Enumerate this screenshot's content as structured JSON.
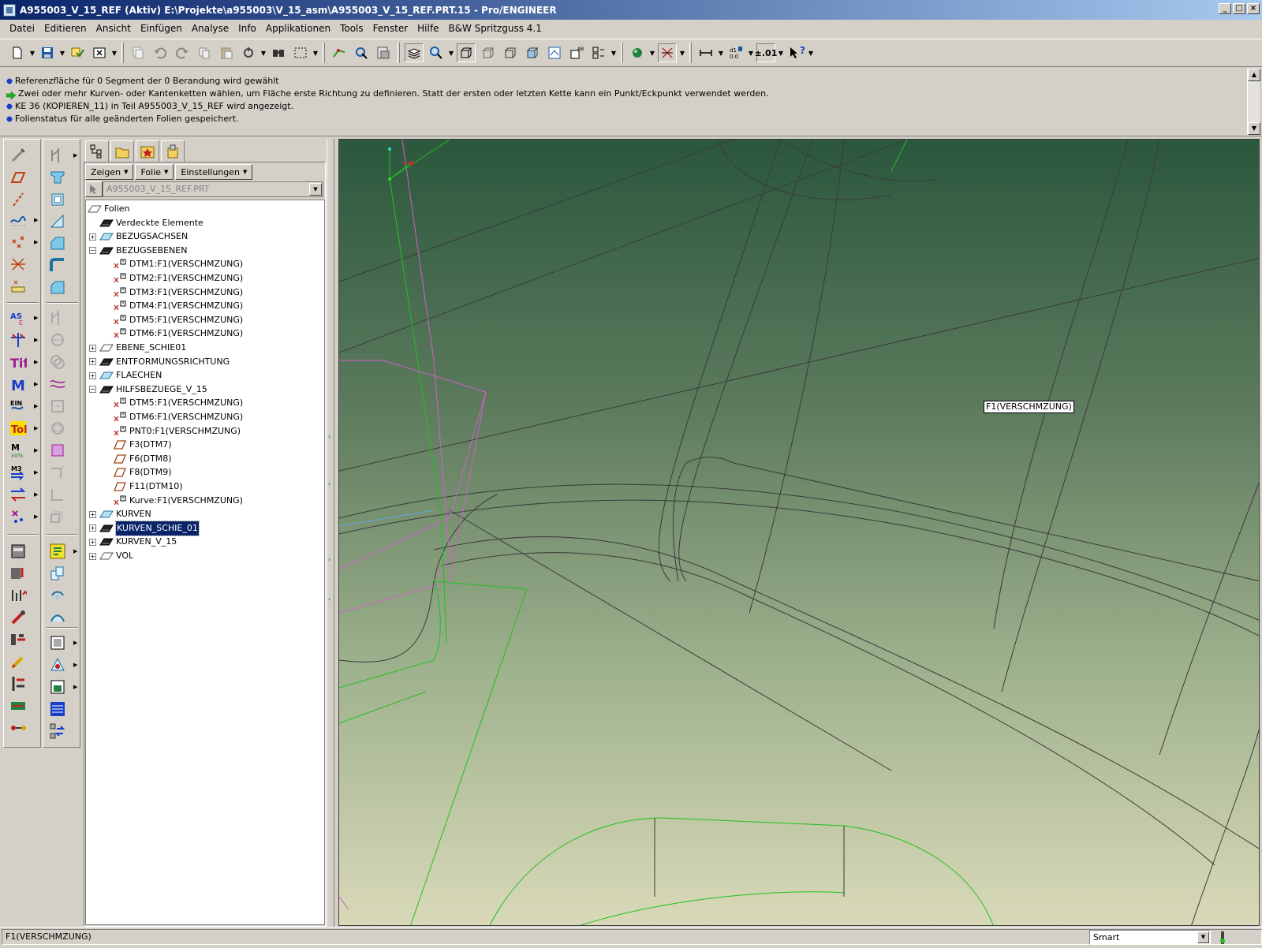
{
  "window": {
    "title": "A955003_V_15_REF (Aktiv) E:\\Projekte\\a955003\\V_15_asm\\A955003_V_15_REF.PRT.15 - Pro/ENGINEER",
    "buttons": [
      "_",
      "□",
      "×"
    ]
  },
  "menu": [
    "Datei",
    "Editieren",
    "Ansicht",
    "Einfügen",
    "Analyse",
    "Info",
    "Applikationen",
    "Tools",
    "Fenster",
    "Hilfe",
    "B&W Spritzguss 4.1"
  ],
  "toolbar": {
    "tolerance_label": "±.01",
    "help_label": "?"
  },
  "messages": [
    {
      "type": "info",
      "text": "Referenzfläche für 0 Segment der 0 Berandung wird gewählt"
    },
    {
      "type": "prompt",
      "text": "Zwei oder mehr Kurven- oder Kantenketten wählen, um Fläche erste Richtung zu definieren. Statt der ersten oder letzten Kette kann ein Punkt/Eckpunkt verwendet werden."
    },
    {
      "type": "info",
      "text": "KE 36 (KOPIEREN_11) in Teil A955003_V_15_REF wird angezeigt."
    },
    {
      "type": "info",
      "text": "Folienstatus für alle geänderten Folien gespeichert."
    }
  ],
  "tree": {
    "buttons": [
      "Zeigen",
      "Folie",
      "Einstellungen"
    ],
    "model_selector": "A955003_V_15_REF.PRT",
    "root": "Folien",
    "items": [
      {
        "label": "Verdeckte Elemente",
        "level": 1,
        "expander": "",
        "icon": "layer-dark"
      },
      {
        "label": "BEZUGSACHSEN",
        "level": 1,
        "expander": "+",
        "icon": "layer-light"
      },
      {
        "label": "BEZUGSEBENEN",
        "level": 1,
        "expander": "−",
        "icon": "layer-dark"
      },
      {
        "label": "DTM1:F1(VERSCHMZUNG)",
        "level": 2,
        "expander": "",
        "icon": "datum"
      },
      {
        "label": "DTM2:F1(VERSCHMZUNG)",
        "level": 2,
        "expander": "",
        "icon": "datum"
      },
      {
        "label": "DTM3:F1(VERSCHMZUNG)",
        "level": 2,
        "expander": "",
        "icon": "datum"
      },
      {
        "label": "DTM4:F1(VERSCHMZUNG)",
        "level": 2,
        "expander": "",
        "icon": "datum"
      },
      {
        "label": "DTM5:F1(VERSCHMZUNG)",
        "level": 2,
        "expander": "",
        "icon": "datum"
      },
      {
        "label": "DTM6:F1(VERSCHMZUNG)",
        "level": 2,
        "expander": "",
        "icon": "datum"
      },
      {
        "label": "EBENE_SCHIE01",
        "level": 1,
        "expander": "+",
        "icon": "layer-outline"
      },
      {
        "label": "ENTFORMUNGSRICHTUNG",
        "level": 1,
        "expander": "+",
        "icon": "layer-dark"
      },
      {
        "label": "FLAECHEN",
        "level": 1,
        "expander": "+",
        "icon": "layer-light"
      },
      {
        "label": "HILFSBEZUEGE_V_15",
        "level": 1,
        "expander": "−",
        "icon": "layer-dark"
      },
      {
        "label": "DTM5:F1(VERSCHMZUNG)",
        "level": 2,
        "expander": "",
        "icon": "datum"
      },
      {
        "label": "DTM6:F1(VERSCHMZUNG)",
        "level": 2,
        "expander": "",
        "icon": "datum"
      },
      {
        "label": "PNT0:F1(VERSCHMZUNG)",
        "level": 2,
        "expander": "",
        "icon": "datum"
      },
      {
        "label": "F3(DTM7)",
        "level": 2,
        "expander": "",
        "icon": "plane"
      },
      {
        "label": "F6(DTM8)",
        "level": 2,
        "expander": "",
        "icon": "plane"
      },
      {
        "label": "F8(DTM9)",
        "level": 2,
        "expander": "",
        "icon": "plane"
      },
      {
        "label": "F11(DTM10)",
        "level": 2,
        "expander": "",
        "icon": "plane"
      },
      {
        "label": "Kurve:F1(VERSCHMZUNG)",
        "level": 2,
        "expander": "",
        "icon": "datum"
      },
      {
        "label": "KURVEN",
        "level": 1,
        "expander": "+",
        "icon": "layer-light"
      },
      {
        "label": "KURVEN_SCHIE_01",
        "level": 1,
        "expander": "+",
        "icon": "layer-dark",
        "selected": true
      },
      {
        "label": "KURVEN_V_15",
        "level": 1,
        "expander": "+",
        "icon": "layer-dark"
      },
      {
        "label": "VOL",
        "level": 1,
        "expander": "+",
        "icon": "layer-outline"
      }
    ]
  },
  "graphics": {
    "tooltip": "F1(VERSCHMZUNG)",
    "colors": {
      "bg_top": "#2b573d",
      "bg_bottom": "#d9d9b8",
      "edge": "#3a3a3a",
      "datum": "#d060c8",
      "highlight": "#20c020"
    }
  },
  "status": {
    "text": "F1(VERSCHMZUNG)",
    "filter": "Smart"
  }
}
